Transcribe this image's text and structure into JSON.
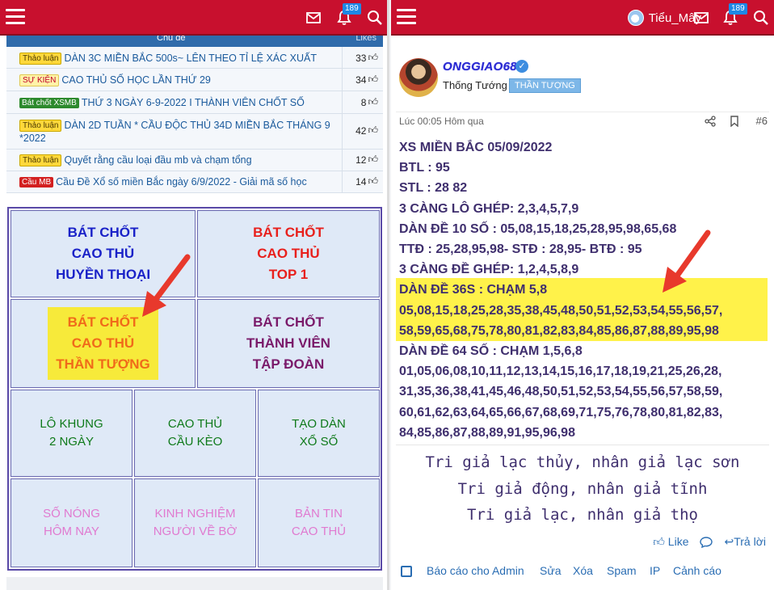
{
  "left": {
    "badge": "189",
    "list": {
      "header_title": "Chủ đề",
      "header_likes": "Likes",
      "rows": [
        {
          "tag": "Thảo luận",
          "title": "DÀN 3C MIỀN BẮC 500s~ LÊN THEO TỈ LỆ XÁC XUẤT",
          "likes": "33"
        },
        {
          "tag": "SỰ KIỆN",
          "title": "CAO THỦ SỐ HỌC LẦN THỨ 29",
          "likes": "34"
        },
        {
          "tag": "Bát chốt XSMB",
          "title": "THỨ 3 NGÀY 6-9-2022 I THÀNH VIÊN CHỐT SỐ",
          "likes": "8"
        },
        {
          "tag": "Thảo luận",
          "title": "DÀN 2D TUẦN * CẦU ĐỘC THỦ 34D MIỀN BẮC THÁNG 9 *2022",
          "likes": "42"
        },
        {
          "tag": "Thảo luận",
          "title": "Quyết rằng cầu loại đầu mb và chạm tổng",
          "likes": "12"
        },
        {
          "tag": "Cầu MB",
          "title": "Cầu Đề Xổ số miền Bắc ngày 6/9/2022 - Giải mã số học",
          "likes": "14"
        }
      ]
    },
    "grid": [
      {
        "label": "BÁT CHỐT\nCAO THỦ\nHUYỀN THOẠI",
        "color": "#1a22c8"
      },
      {
        "label": "BÁT CHỐT\nCAO THỦ\nTOP 1",
        "color": "#e8201c"
      },
      {
        "label": "BÁT CHỐT\nCAO THỦ\nTHẦN TƯỢNG",
        "color": "#f06a1a"
      },
      {
        "label": "BÁT CHỐT\nTHÀNH VIÊN\nTẬP ĐOÀN",
        "color": "#7a1a6a"
      },
      {
        "label": "LÔ KHUNG\n2 NGÀY",
        "color": "#0f7a1a"
      },
      {
        "label": "CAO THỦ\nCẦU KÈO",
        "color": "#0f7a1a"
      },
      {
        "label": "TẠO DÀN\nXỔ SỐ",
        "color": "#0f7a1a"
      },
      {
        "label": "SỐ NÓNG\nHÔM NAY",
        "color": "#e07ad0"
      },
      {
        "label": "KINH NGHIỆM\nNGƯỜI VỀ BỜ",
        "color": "#e07ad0"
      },
      {
        "label": "BẢN TIN\nCAO THỦ",
        "color": "#e07ad0"
      }
    ]
  },
  "right": {
    "username_top": "Tiểu_Mây",
    "badge": "189",
    "post": {
      "author": "ONGGIAO68",
      "rank": "Thống Tướng",
      "rank_badge": "THẦN TƯỢNG",
      "time": "Lúc 00:05 Hôm qua",
      "post_number": "#6",
      "lines": [
        "XS MIỀN BẮC 05/09/2022",
        "BTL : 95",
        "STL : 28 82",
        "3 CÀNG LÔ GHÉP: 2,3,4,5,7,9",
        "DÀN ĐỀ 10 SỐ : 05,08,15,18,25,28,95,98,65,68",
        "TTĐ : 25,28,95,98- STĐ : 28,95- BTĐ : 95",
        "3 CÀNG ĐỀ GHÉP: 1,2,4,5,8,9",
        "DÀN ĐỀ 36S : CHẠM 5,8",
        "05,08,15,18,25,28,35,38,45,48,50,51,52,53,54,55,56,57,",
        "58,59,65,68,75,78,80,81,82,83,84,85,86,87,88,89,95,98",
        "DÀN ĐỀ 64 SỐ : CHẠM 1,5,6,8",
        "01,05,06,08,10,11,12,13,14,15,16,17,18,19,21,25,26,28,",
        "31,35,36,38,41,45,46,48,50,51,52,53,54,55,56,57,58,59,",
        "60,61,62,63,64,65,66,67,68,69,71,75,76,78,80,81,82,83,",
        "84,85,86,87,88,89,91,95,96,98"
      ],
      "quote": [
        "Tri giả lạc thủy, nhân giả lạc sơn",
        "Tri giả động, nhân giả tĩnh",
        "Tri giả lạc, nhân giả thọ"
      ],
      "like_label": "Like",
      "reply_label": "Trả lời",
      "footer": {
        "report": "Báo cáo cho Admin",
        "edit": "Sửa",
        "delete": "Xóa",
        "spam": "Spam",
        "ip": "IP",
        "warn": "Cảnh cáo"
      }
    }
  }
}
